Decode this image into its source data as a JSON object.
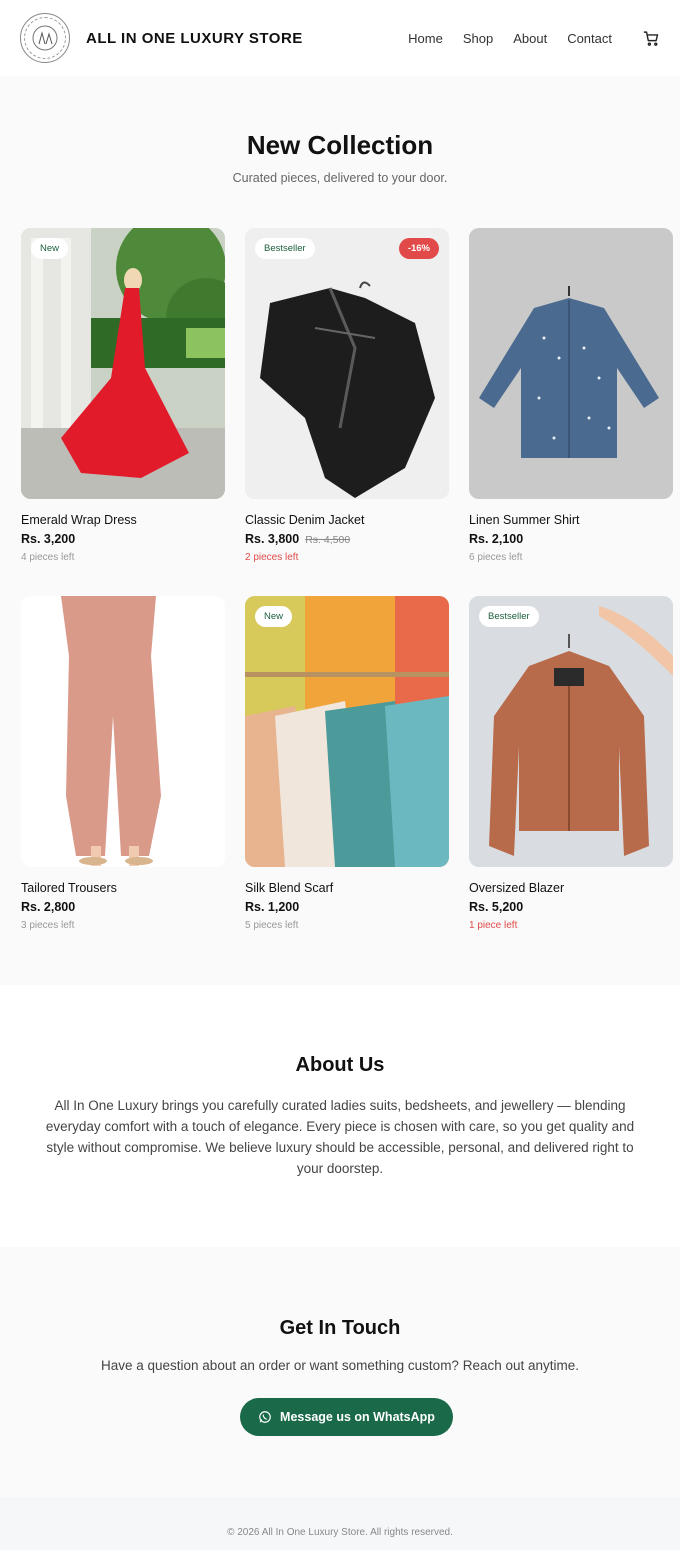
{
  "header": {
    "brand": "ALL IN ONE LUXURY STORE",
    "nav": [
      "Home",
      "Shop",
      "About",
      "Contact"
    ],
    "cart_icon": "cart-icon"
  },
  "collection": {
    "title": "New Collection",
    "subtitle": "Curated pieces, delivered to your door.",
    "products": [
      {
        "name": "Emerald Wrap Dress",
        "price": "Rs. 3,200",
        "old_price": "",
        "stock": "4 pieces left",
        "stock_low": false,
        "badge": "New",
        "discount": ""
      },
      {
        "name": "Classic Denim Jacket",
        "price": "Rs. 3,800",
        "old_price": "Rs. 4,500",
        "stock": "2 pieces left",
        "stock_low": true,
        "badge": "Bestseller",
        "discount": "-16%"
      },
      {
        "name": "Linen Summer Shirt",
        "price": "Rs. 2,100",
        "old_price": "",
        "stock": "6 pieces left",
        "stock_low": false,
        "badge": "",
        "discount": ""
      },
      {
        "name": "Tailored Trousers",
        "price": "Rs. 2,800",
        "old_price": "",
        "stock": "3 pieces left",
        "stock_low": false,
        "badge": "",
        "discount": ""
      },
      {
        "name": "Silk Blend Scarf",
        "price": "Rs. 1,200",
        "old_price": "",
        "stock": "5 pieces left",
        "stock_low": false,
        "badge": "New",
        "discount": ""
      },
      {
        "name": "Oversized Blazer",
        "price": "Rs. 5,200",
        "old_price": "",
        "stock": "1 piece left",
        "stock_low": true,
        "badge": "Bestseller",
        "discount": ""
      }
    ]
  },
  "about": {
    "title": "About Us",
    "text": "All In One Luxury brings you carefully curated ladies suits, bedsheets, and jewellery — blending everyday comfort with a touch of elegance. Every piece is chosen with care, so you get quality and style without compromise. We believe luxury should be accessible, personal, and delivered right to your doorstep."
  },
  "contact": {
    "title": "Get In Touch",
    "text": "Have a question about an order or want something custom? Reach out anytime.",
    "button_label": "Message us on WhatsApp"
  },
  "footer": {
    "text": "© 2026 All In One Luxury Store. All rights reserved."
  },
  "colors": {
    "accent": "#1a6a4a",
    "discount": "#e24a4a",
    "low_stock": "#e24a4a"
  }
}
